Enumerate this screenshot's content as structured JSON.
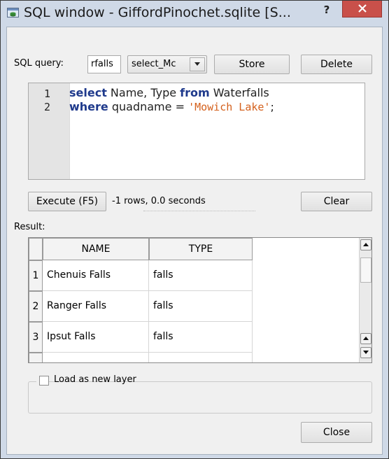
{
  "window": {
    "title": "SQL window - GiffordPinochet.sqlite [S...",
    "help_label": "?",
    "icon": "sql-window-icon"
  },
  "query_bar": {
    "label": "SQL query:",
    "query_name_value": "rfalls",
    "stored_query_value": "select_Mc",
    "store_label": "Store",
    "delete_label": "Delete"
  },
  "editor": {
    "line_numbers": [
      "1",
      "2"
    ],
    "lines": [
      {
        "kw1": "select",
        "t1": " Name",
        "t2": ", Type ",
        "kw2": "from",
        "t3": " Waterfalls"
      },
      {
        "kw1": "where",
        "t1": " quadname = ",
        "str": "'Mowich Lake'",
        "t2": ";"
      }
    ]
  },
  "execute": {
    "execute_label": "Execute (F5)",
    "status": "-1 rows, 0.0 seconds",
    "clear_label": "Clear"
  },
  "result": {
    "label": "Result:",
    "columns": [
      "NAME",
      "TYPE"
    ],
    "rows": [
      {
        "num": "1",
        "name": "Chenuis Falls",
        "type": "falls"
      },
      {
        "num": "2",
        "name": "Ranger Falls",
        "type": "falls"
      },
      {
        "num": "3",
        "name": "Ipsut Falls",
        "type": "falls"
      }
    ]
  },
  "layer": {
    "load_label": "Load as new layer",
    "checked": false
  },
  "footer": {
    "close_label": "Close"
  },
  "colors": {
    "titlebar": "#cfd9e7",
    "close_button": "#c9504a",
    "keyword": "#1f3a8c",
    "string": "#d4601c"
  }
}
